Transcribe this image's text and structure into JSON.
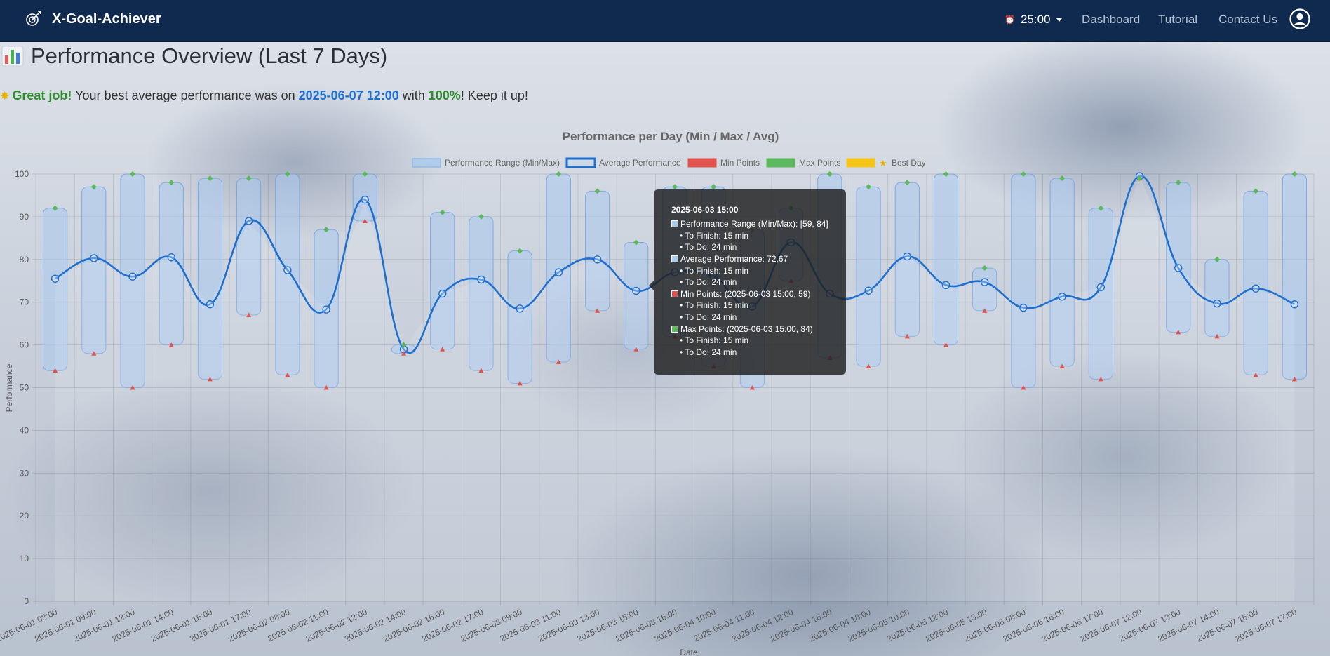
{
  "navbar": {
    "brand": "X-Goal-Achiever",
    "timer": "25:00",
    "links": [
      "Dashboard",
      "Tutorial",
      "Contact Us"
    ]
  },
  "page": {
    "title": "Performance Overview (Last 7 Days)",
    "message": {
      "great": "Great job!",
      "part1": " Your best average performance was on ",
      "date": "2025-06-07 12:00",
      "part2": " with ",
      "pct": "100%",
      "part3": "! Keep it up!"
    }
  },
  "tooltip": {
    "title": "2025-06-03 15:00",
    "range": "Performance Range (Min/Max): [59, 84]",
    "avg": "Average Performance: 72,67",
    "min": "Min Points: (2025-06-03 15:00, 59)",
    "max": "Max Points: (2025-06-03 15:00, 84)",
    "finish": "• To Finish: 15 min",
    "todo": "• To Do: 24 min"
  },
  "colors": {
    "navbar": "#0f2a4e",
    "range_fill": "#a9c9ee",
    "avg_line": "#1f6fce",
    "min_points": "#e0524b",
    "max_points": "#5cb85c",
    "best_day": "#f5c518"
  },
  "chart_data": {
    "type": "line",
    "title": "Performance per Day (Min / Max / Avg)",
    "xlabel": "Date",
    "ylabel": "Performance",
    "ylim": [
      0,
      100
    ],
    "yticks": [
      0,
      10,
      20,
      30,
      40,
      50,
      60,
      70,
      80,
      90,
      100
    ],
    "grid": true,
    "legend_position": "top",
    "legend": [
      "Performance Range (Min/Max)",
      "Average Performance",
      "Min Points",
      "Max Points",
      "Best Day"
    ],
    "categories": [
      "2025-06-01 08:00",
      "2025-06-01 09:00",
      "2025-06-01 12:00",
      "2025-06-01 14:00",
      "2025-06-01 16:00",
      "2025-06-01 17:00",
      "2025-06-02 08:00",
      "2025-06-02 11:00",
      "2025-06-02 12:00",
      "2025-06-02 14:00",
      "2025-06-02 16:00",
      "2025-06-02 17:00",
      "2025-06-03 09:00",
      "2025-06-03 11:00",
      "2025-06-03 13:00",
      "2025-06-03 15:00",
      "2025-06-03 16:00",
      "2025-06-04 10:00",
      "2025-06-04 11:00",
      "2025-06-04 12:00",
      "2025-06-04 16:00",
      "2025-06-04 18:00",
      "2025-06-05 10:00",
      "2025-06-05 12:00",
      "2025-06-05 13:00",
      "2025-06-06 08:00",
      "2025-06-06 16:00",
      "2025-06-06 17:00",
      "2025-06-07 12:00",
      "2025-06-07 13:00",
      "2025-06-07 14:00",
      "2025-06-07 16:00",
      "2025-06-07 17:00"
    ],
    "series": [
      {
        "name": "Min Points",
        "values": [
          54,
          58,
          50,
          60,
          52,
          67,
          53,
          50,
          89,
          58,
          59,
          54,
          51,
          56,
          68,
          59,
          62,
          55,
          50,
          75,
          57,
          55,
          62,
          60,
          68,
          50,
          55,
          52,
          99,
          63,
          62,
          53,
          52
        ]
      },
      {
        "name": "Max Points",
        "values": [
          92,
          97,
          100,
          98,
          99,
          99,
          100,
          87,
          100,
          60,
          91,
          90,
          82,
          100,
          96,
          84,
          97,
          97,
          87,
          92,
          100,
          97,
          98,
          100,
          78,
          100,
          99,
          92,
          99,
          98,
          80,
          96,
          100
        ]
      },
      {
        "name": "Average Performance",
        "values": [
          75.5,
          80.3,
          76,
          80.5,
          69.5,
          89,
          77.5,
          68.3,
          94,
          59,
          72,
          75.3,
          68.5,
          77,
          80,
          72.67,
          77,
          76,
          69,
          84,
          72,
          72.7,
          80.7,
          74,
          74.7,
          68.7,
          71.3,
          73.5,
          99.5,
          78,
          69.7,
          73.2,
          69.5
        ]
      }
    ]
  }
}
